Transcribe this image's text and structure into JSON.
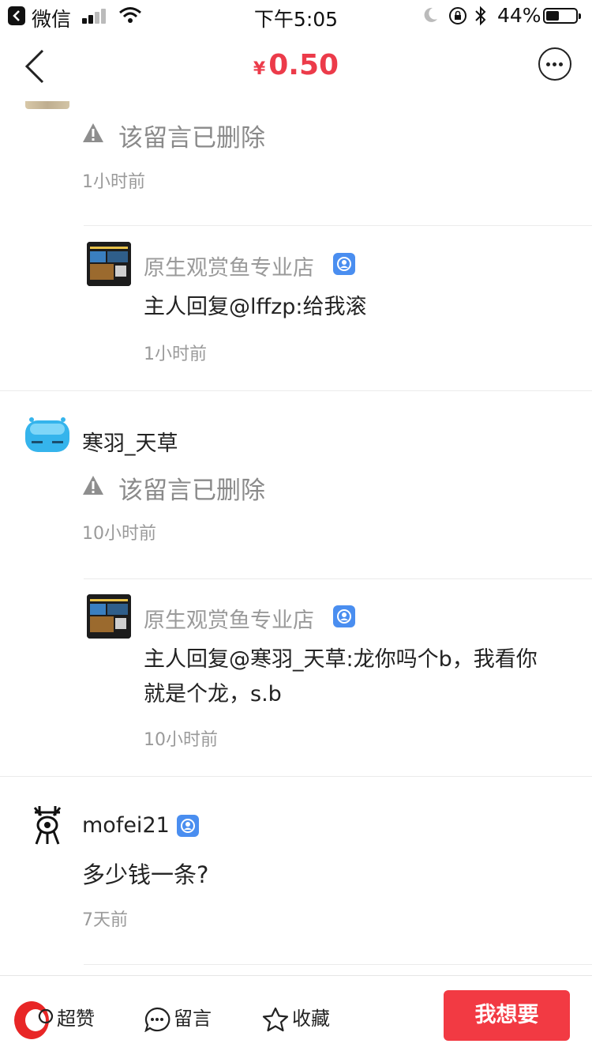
{
  "status_bar": {
    "app_name": "微信",
    "time": "下午5:05",
    "battery_percent": "44%",
    "battery_level": 0.44
  },
  "nav": {
    "currency": "¥",
    "price": "0.50"
  },
  "thread": {
    "top_comment": {
      "deleted_text": "该留言已删除",
      "time": "1小时前"
    },
    "top_reply": {
      "shop_name": "原生观赏鱼专业店",
      "text": "主人回复@lffzp:给我滚",
      "time": "1小时前"
    },
    "comment2": {
      "user": "寒羽_天草",
      "deleted_text": "该留言已删除",
      "time": "10小时前"
    },
    "reply2": {
      "shop_name": "原生观赏鱼专业店",
      "text_line1": "主人回复@寒羽_天草:龙你吗个b，我看你",
      "text_line2": "就是个龙，s.b",
      "time": "10小时前"
    },
    "comment3": {
      "user": "mofei21",
      "text": "多少钱一条?",
      "time": "7天前"
    }
  },
  "bottom_bar": {
    "like_label": "超赞",
    "comment_label": "留言",
    "favorite_label": "收藏",
    "want_label": "我想要"
  },
  "colors": {
    "price": "#ec3b4a",
    "want_button": "#f23a43",
    "verified": "#4a8ef0"
  }
}
